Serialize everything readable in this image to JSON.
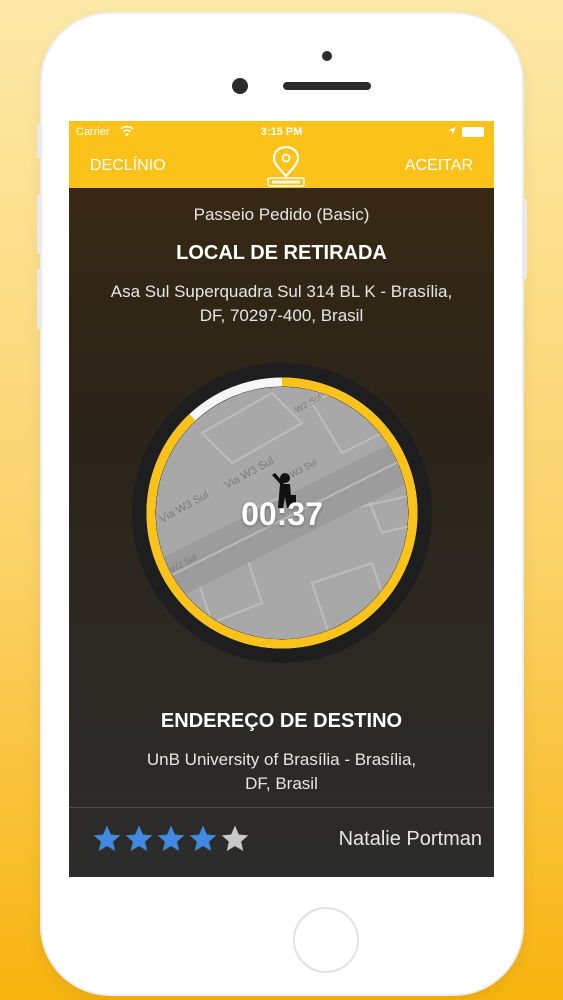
{
  "status_bar": {
    "carrier": "Carrier",
    "time": "3:15 PM"
  },
  "nav": {
    "decline_label": "DECLÍNIO",
    "accept_label": "ACEITAR",
    "logo_icon": "taxi-pin-icon"
  },
  "ride": {
    "type": "Passeio Pedido (Basic)",
    "pickup_title": "LOCAL DE RETIRADA",
    "pickup_address_line1": "Asa Sul Superquadra Sul 314 BL K - Brasília,",
    "pickup_address_line2": "DF,  70297-400,  Brasil",
    "timer": "00:37",
    "timer_progress": 0.88,
    "map_labels": [
      "Via W3 Sul",
      "Via W3 Sul",
      "W3 Sul",
      "W2 Sul",
      "W2 Sul"
    ],
    "dest_title": "ENDEREÇO DE DESTINO",
    "dest_address_line1": "UnB University of Brasília - Brasília,",
    "dest_address_line2": "DF, Brasil"
  },
  "passenger": {
    "name": "Natalie Portman",
    "rating": 4,
    "rating_max": 5
  },
  "colors": {
    "accent": "#fbc21a",
    "star_filled": "#3f8ae0",
    "star_empty": "#c8c8c8"
  }
}
